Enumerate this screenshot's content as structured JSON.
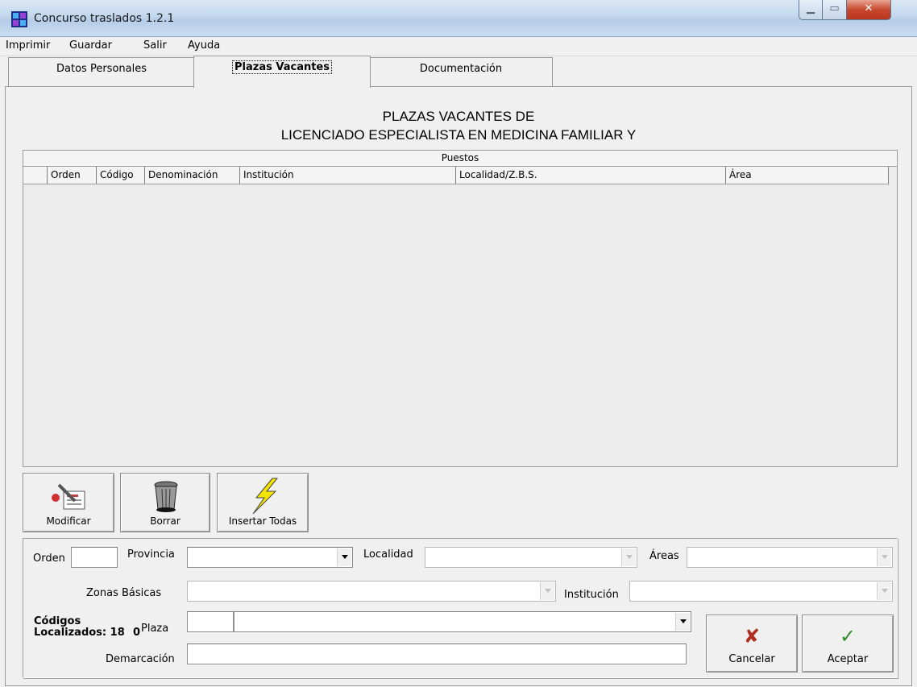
{
  "window": {
    "title": "Concurso traslados 1.2.1"
  },
  "menu": [
    "Imprimir",
    "Guardar",
    "Salir",
    "Ayuda"
  ],
  "tabs": [
    "Datos Personales",
    "Plazas Vacantes",
    "Documentación"
  ],
  "active_tab": "Plazas Vacantes",
  "heading": {
    "line1": "PLAZAS VACANTES DE",
    "line2": "LICENCIADO ESPECIALISTA EN MEDICINA FAMILIAR Y"
  },
  "grid": {
    "band": "Puestos",
    "columns": [
      "Orden",
      "Código",
      "Denominación",
      "Institución",
      "Localidad/Z.B.S.",
      "Área"
    ],
    "rows": []
  },
  "toolbar": {
    "modify": "Modificar",
    "delete": "Borrar",
    "insert_all": "Insertar Todas"
  },
  "form": {
    "orden_label": "Orden",
    "provincia_label": "Provincia",
    "localidad_label": "Localidad",
    "areas_label": "Áreas",
    "zonas_label": "Zonas Básicas",
    "institucion_label": "Institución",
    "codigos_line1": "Códigos",
    "codigos_line2": "Localizados: 18",
    "codigos_suffix": "0",
    "plaza_label": "Plaza",
    "demarcacion_label": "Demarcación"
  },
  "actions": {
    "cancel": "Cancelar",
    "accept": "Aceptar"
  },
  "colors": {
    "cancel_icon": "#c0392b",
    "accept_icon": "#2e8b2e",
    "insert_icon": "#f5e400"
  }
}
